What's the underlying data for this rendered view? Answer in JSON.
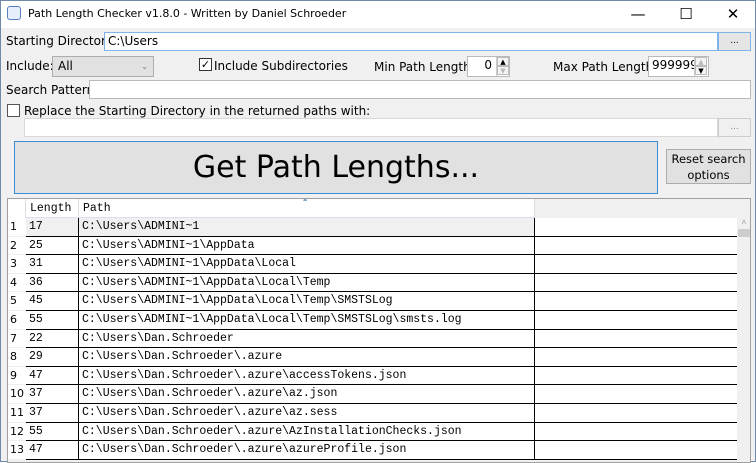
{
  "window": {
    "title": "Path Length Checker v1.8.0 - Written by Daniel Schroeder",
    "minimize": "—",
    "maximize": "☐",
    "close": "✕"
  },
  "form": {
    "starting_directory_label": "Starting Directory:",
    "starting_directory_value": "C:\\Users",
    "browse_label": "...",
    "include_label": "Include:",
    "include_value": "All",
    "include_subdirs_label": "Include Subdirectories",
    "include_subdirs_checked": true,
    "min_label": "Min Path Length:",
    "min_value": "0",
    "max_label": "Max Path Length:",
    "max_value": "999999",
    "search_pattern_label": "Search Pattern:",
    "search_pattern_value": "",
    "replace_label": "Replace the Starting Directory in the returned paths with:",
    "replace_checked": false,
    "replace_value": "",
    "replace_browse_label": "..."
  },
  "actions": {
    "get_path_lengths": "Get Path Lengths...",
    "reset_line1": "Reset search",
    "reset_line2": "options"
  },
  "grid": {
    "columns": [
      "Length",
      "Path"
    ],
    "rows": [
      {
        "n": "1",
        "length": "17",
        "path": "C:\\Users\\ADMINI~1"
      },
      {
        "n": "2",
        "length": "25",
        "path": "C:\\Users\\ADMINI~1\\AppData"
      },
      {
        "n": "3",
        "length": "31",
        "path": "C:\\Users\\ADMINI~1\\AppData\\Local"
      },
      {
        "n": "4",
        "length": "36",
        "path": "C:\\Users\\ADMINI~1\\AppData\\Local\\Temp"
      },
      {
        "n": "5",
        "length": "45",
        "path": "C:\\Users\\ADMINI~1\\AppData\\Local\\Temp\\SMSTSLog"
      },
      {
        "n": "6",
        "length": "55",
        "path": "C:\\Users\\ADMINI~1\\AppData\\Local\\Temp\\SMSTSLog\\smsts.log"
      },
      {
        "n": "7",
        "length": "22",
        "path": "C:\\Users\\Dan.Schroeder"
      },
      {
        "n": "8",
        "length": "29",
        "path": "C:\\Users\\Dan.Schroeder\\.azure"
      },
      {
        "n": "9",
        "length": "47",
        "path": "C:\\Users\\Dan.Schroeder\\.azure\\accessTokens.json"
      },
      {
        "n": "10",
        "length": "37",
        "path": "C:\\Users\\Dan.Schroeder\\.azure\\az.json"
      },
      {
        "n": "11",
        "length": "37",
        "path": "C:\\Users\\Dan.Schroeder\\.azure\\az.sess"
      },
      {
        "n": "12",
        "length": "55",
        "path": "C:\\Users\\Dan.Schroeder\\.azure\\AzInstallationChecks.json"
      },
      {
        "n": "13",
        "length": "47",
        "path": "C:\\Users\\Dan.Schroeder\\.azure\\azureProfile.json"
      }
    ]
  }
}
